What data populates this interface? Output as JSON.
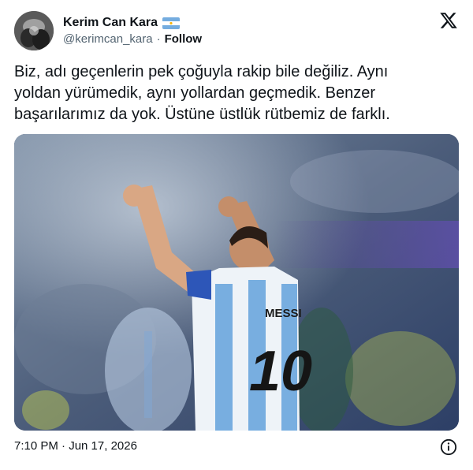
{
  "author": {
    "display_name": "Kerim Can Kara",
    "handle": "@kerimcan_kara",
    "separator": "·",
    "follow_label": "Follow",
    "flag_icon": "argentina-flag-icon"
  },
  "brand": {
    "logo_icon": "x-logo-icon",
    "color": "#0f1419"
  },
  "tweet": {
    "text": "Biz, adı geçenlerin pek çoğuyla rakip bile değiliz. Aynı\nyoldan yürümedik, aynı yollardan geçmedik. Benzer\nbaşarılarımız da yok. Üstüne üstlük rütbemiz de farklı.",
    "media": {
      "type": "photo",
      "jersey_name": "MESSI",
      "jersey_number": "10"
    }
  },
  "footer": {
    "timestamp": "7:10 PM · Jun 17, 2026",
    "info_icon": "info-icon"
  },
  "colors": {
    "text_primary": "#0f1419",
    "text_secondary": "#536471",
    "flag_blue": "#74acdf"
  }
}
